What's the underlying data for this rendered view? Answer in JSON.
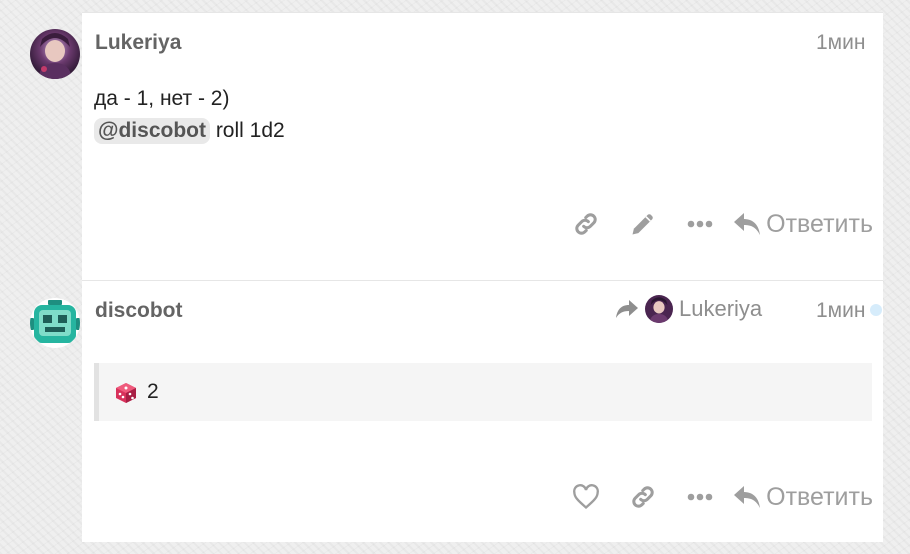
{
  "post1": {
    "username": "Lukeriya",
    "time": "1мин",
    "line1": "да - 1, нет - 2)",
    "mention": "@discobot",
    "command": " roll 1d2",
    "reply_label": "Ответить",
    "icons": [
      "link-icon",
      "pencil-icon",
      "more-icon",
      "reply-icon"
    ]
  },
  "post2": {
    "username": "discobot",
    "reply_to": "Lukeriya",
    "time": "1мин",
    "dice_value": "2",
    "reply_label": "Ответить",
    "icons": [
      "heart-icon",
      "link-icon",
      "more-icon",
      "reply-icon"
    ]
  },
  "colors": {
    "action_gray": "#9e9e9e",
    "username_gray": "#646464",
    "bot_teal": "#26b5a0",
    "unread_dot": "#d6ecfb"
  }
}
